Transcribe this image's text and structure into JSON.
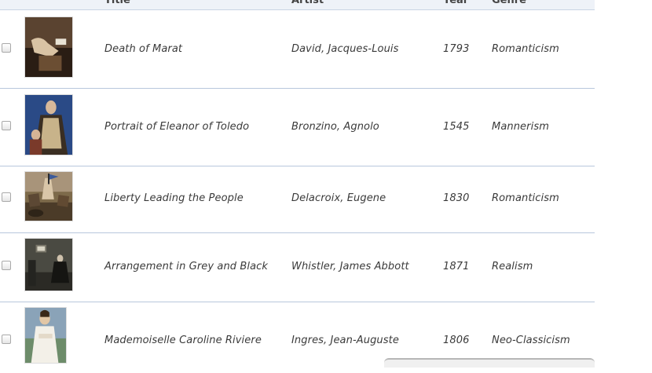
{
  "columns": {
    "title": "Title",
    "artist": "Artist",
    "year": "Year",
    "genre": "Genre"
  },
  "rows": [
    {
      "title": "Death of Marat",
      "artist": "David, Jacques-Louis",
      "year": "1793",
      "genre": "Romanticism"
    },
    {
      "title": "Portrait of Eleanor of Toledo",
      "artist": "Bronzino, Agnolo",
      "year": "1545",
      "genre": "Mannerism"
    },
    {
      "title": "Liberty Leading the People",
      "artist": "Delacroix, Eugene",
      "year": "1830",
      "genre": "Romanticism"
    },
    {
      "title": "Arrangement in Grey and Black",
      "artist": "Whistler, James Abbott",
      "year": "1871",
      "genre": "Realism"
    },
    {
      "title": "Mademoiselle Caroline Riviere",
      "artist": "Ingres, Jean-Auguste",
      "year": "1806",
      "genre": "Neo-Classicism"
    }
  ],
  "icons": {
    "checkbox": "checkbox-icon",
    "thumbnail": "painting-thumbnail"
  },
  "colors": {
    "header_bg": "#eef2f8",
    "row_divider": "#b8c7dc",
    "text": "#3a3a3a"
  }
}
